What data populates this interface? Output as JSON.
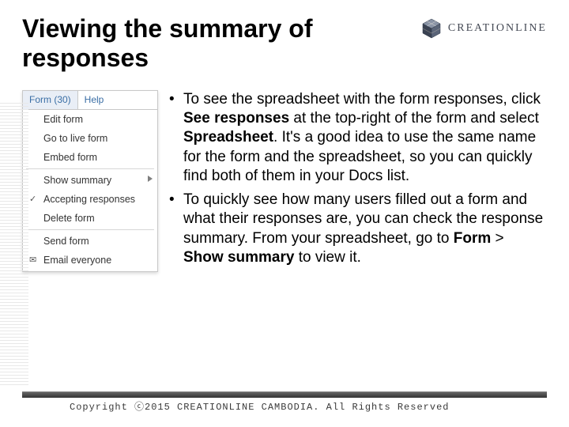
{
  "title": "Viewing the summary of responses",
  "logo": {
    "text": "CREATIONLINE"
  },
  "menu": {
    "tab_active": "Form (30)",
    "tab_help": "Help",
    "items": {
      "edit": "Edit form",
      "live": "Go to live form",
      "embed": "Embed form",
      "show_summary": "Show summary",
      "accepting": "Accepting responses",
      "delete": "Delete form",
      "send": "Send form",
      "email": "Email everyone"
    }
  },
  "bullets": {
    "b1_pre": "To see the spreadsheet with the form responses, click ",
    "b1_bold1": "See responses",
    "b1_mid": " at the top-right of the form and select ",
    "b1_bold2": "Spreadsheet",
    "b1_post": ". It's a good idea to use the same name for the form and the spreadsheet, so you can quickly find both of them in your Docs list.",
    "b2_pre": "To quickly see how many users filled out a form and what their responses are, you can check the response summary. From your spreadsheet, go to ",
    "b2_bold1": "Form",
    "b2_mid": " > ",
    "b2_bold2": "Show summary",
    "b2_post": " to view it."
  },
  "footer": "Copyright ⓒ2015 CREATIONLINE CAMBODIA. All Rights Reserved"
}
